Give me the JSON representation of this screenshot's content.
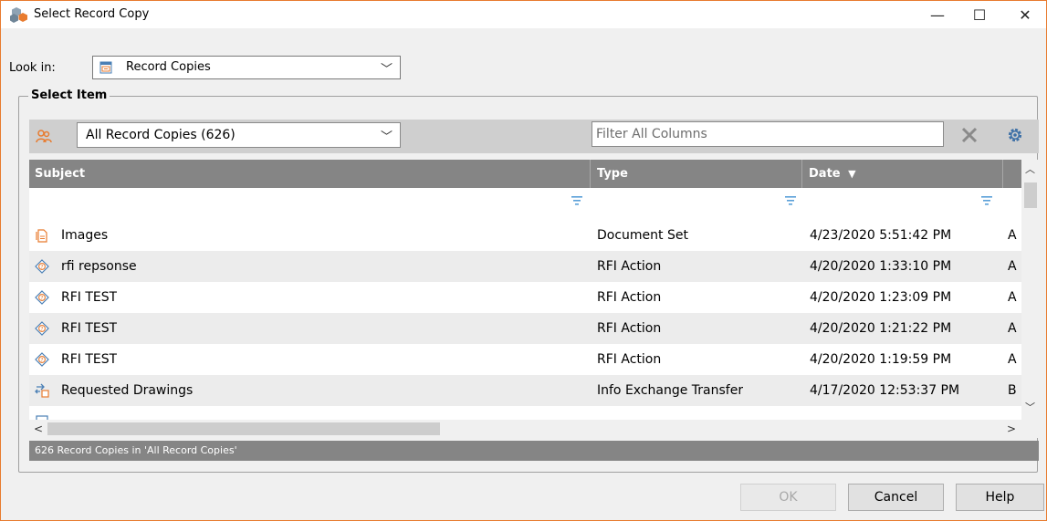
{
  "window": {
    "title": "Select Record Copy",
    "minimize_glyph": "—",
    "maximize_glyph": "☐",
    "close_glyph": "✕",
    "accent_color": "#e87b2f"
  },
  "look_in": {
    "label": "Look in:",
    "value": "Record Copies",
    "icon": "record-copies-icon"
  },
  "group": {
    "legend": "Select Item"
  },
  "toolbar": {
    "view_icon": "users-icon",
    "view_value": "All Record Copies (626)",
    "filter_placeholder": "Filter All Columns",
    "clear_icon": "clear-x-icon",
    "settings_icon": "gear-icon"
  },
  "grid": {
    "columns": [
      {
        "label": "Subject"
      },
      {
        "label": "Type"
      },
      {
        "label": "Date",
        "sort": "▼"
      },
      {
        "label": ""
      }
    ],
    "rows": [
      {
        "icon": "document-set-icon",
        "subject": "Images",
        "type": "Document Set",
        "date": "4/23/2020 5:51:42 PM",
        "extra": "A"
      },
      {
        "icon": "rfi-icon",
        "subject": "rfi repsonse",
        "type": "RFI Action",
        "date": "4/20/2020 1:33:10 PM",
        "extra": "A"
      },
      {
        "icon": "rfi-icon",
        "subject": "RFI TEST",
        "type": "RFI Action",
        "date": "4/20/2020 1:23:09 PM",
        "extra": "A"
      },
      {
        "icon": "rfi-icon",
        "subject": "RFI TEST",
        "type": "RFI Action",
        "date": "4/20/2020 1:21:22 PM",
        "extra": "A"
      },
      {
        "icon": "rfi-icon",
        "subject": "RFI TEST",
        "type": "RFI Action",
        "date": "4/20/2020 1:19:59 PM",
        "extra": "A"
      },
      {
        "icon": "info-exchange-transfer-icon",
        "subject": "Requested Drawings",
        "type": "Info Exchange Transfer",
        "date": "4/17/2020 12:53:37 PM",
        "extra": "B"
      }
    ],
    "status": "626 Record Copies in 'All Record Copies'"
  },
  "buttons": {
    "ok": "OK",
    "cancel": "Cancel",
    "help": "Help"
  }
}
